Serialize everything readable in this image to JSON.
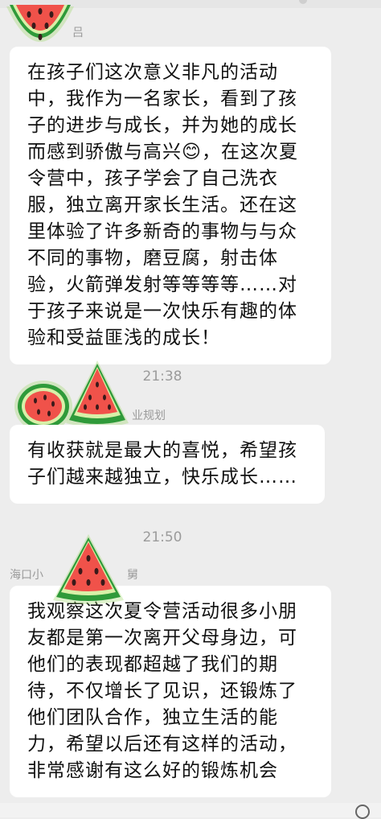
{
  "chat": {
    "messages": [
      {
        "sender": "",
        "text": "在孩子们这次意义非凡的活动\n中，我作为一名家长，看到了孩\n子的进步与成长，并为她的成长\n而感到骄傲与高兴😊，在这次夏\n令营中，孩子学会了自己洗衣\n服，独立离开家长生活。还在这\n里体验了许多新奇的事物与与众\n不同的事物，磨豆腐，射击体\n验，火箭弹发射等等等等……对\n于孩子来说是一次快乐有趣的体\n验和受益匪浅的成长！"
      },
      {
        "time": "21:38",
        "sender": "业规划",
        "text": "有收获就是最大的喜悦，希望孩\n子们越来越独立，快乐成长……"
      },
      {
        "time": "21:50",
        "sender_left": "海口小",
        "sender_right": "舅",
        "text": "我观察这次夏令营活动很多小朋\n友都是第一次离开父母身边，可\n他们的表现都超越了我们的期\n待，不仅增长了见识，还锻炼了\n他们团队合作，独立生活的能\n力，希望以后还有这样的活动，\n非常感谢有这么好的锻炼机会"
      }
    ]
  },
  "stickers": [
    "watermelon-sticker",
    "watermelon-sticker",
    "watermelon-sticker",
    "watermelon-sticker"
  ],
  "colors": {
    "background": "#ededed",
    "bubble": "#ffffff",
    "watermelon_flesh": "#f0524a",
    "watermelon_rind": "#3aa63a"
  }
}
